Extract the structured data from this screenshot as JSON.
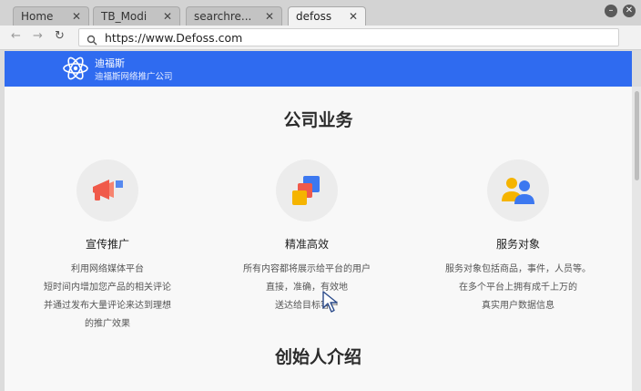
{
  "browser": {
    "tabs": [
      {
        "label": "Home"
      },
      {
        "label": "TB_Modi"
      },
      {
        "label": "searchre..."
      },
      {
        "label": "defoss"
      }
    ],
    "url": "https://www.Defoss.com"
  },
  "site": {
    "brand_name": "迪福斯",
    "brand_sub": "迪福斯网络推广公司"
  },
  "business": {
    "title": "公司业务",
    "items": [
      {
        "title": "宣传推广",
        "lines": [
          "利用网络媒体平台",
          "短时间内增加您产品的相关评论",
          "并通过发布大量评论来达到理想",
          "的推广效果"
        ],
        "icon": "megaphone-icon"
      },
      {
        "title": "精准高效",
        "lines": [
          "所有内容都将展示给平台的用户",
          "直接，准确，有效地",
          "送达给目标客户"
        ],
        "icon": "layers-icon"
      },
      {
        "title": "服务对象",
        "lines": [
          "服务对象包括商品，事件，人员等。",
          "在多个平台上拥有成千上万的",
          "真实用户数据信息"
        ],
        "icon": "users-icon"
      }
    ]
  },
  "founder": {
    "title": "创始人介绍"
  },
  "colors": {
    "header_blue": "#2f6bf0",
    "accent_red": "#f05a4a",
    "accent_yellow": "#f5b400",
    "accent_blue": "#3c78f0"
  }
}
